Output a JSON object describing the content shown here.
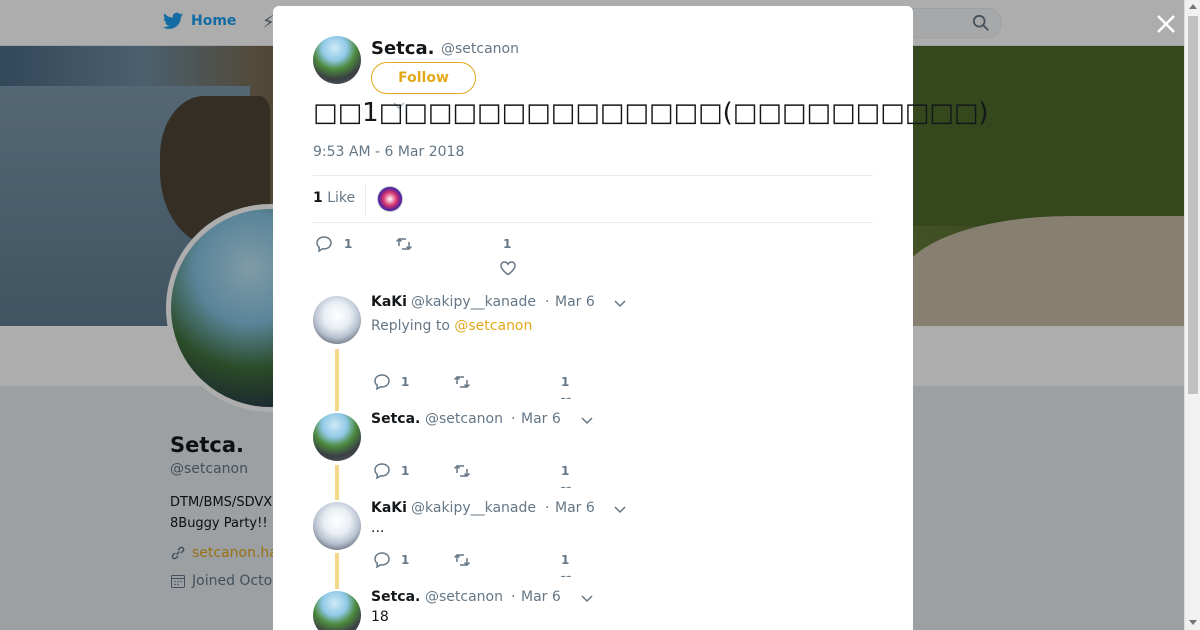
{
  "nav": {
    "home_label": "Home"
  },
  "profile": {
    "name": "Setca.",
    "handle": "@setcanon",
    "bio_line1": "DTM/BMS/SDVX",
    "bio_line2": "8Buggy Party!!",
    "link": "setcanon.ha",
    "joined": "Joined Octo"
  },
  "tweet": {
    "author_name": "Setca.",
    "author_handle": "@setcanon",
    "follow_label": "Follow",
    "text": "□□1□□□□□□□□□□□□□□(□□□□□□□□□□)",
    "timestamp": "9:53 AM - 6 Mar 2018",
    "likes_count": "1",
    "likes_label": "Like",
    "actions": {
      "reply_count": "1",
      "like_count": "1"
    }
  },
  "replies": [
    {
      "name": "KaKi",
      "handle": "@kakipy__kanade",
      "date": "Mar 6",
      "replying_prefix": "Replying to",
      "replying_handle": "@setcanon",
      "text": "",
      "reply_count": "1",
      "like_count": "1"
    },
    {
      "name": "Setca.",
      "handle": "@setcanon",
      "date": "Mar 6",
      "text": "",
      "reply_count": "1",
      "like_count": "1"
    },
    {
      "name": "KaKi",
      "handle": "@kakipy__kanade",
      "date": "Mar 6",
      "text": "...",
      "reply_count": "1",
      "like_count": "1"
    },
    {
      "name": "Setca.",
      "handle": "@setcanon",
      "date": "Mar 6",
      "text": "18"
    }
  ],
  "dot_separator": "·",
  "colors": {
    "accent": "#e2a91b",
    "brand": "#1da1f2",
    "thread_line": "#f5d98a",
    "muted_text": "#657786"
  }
}
